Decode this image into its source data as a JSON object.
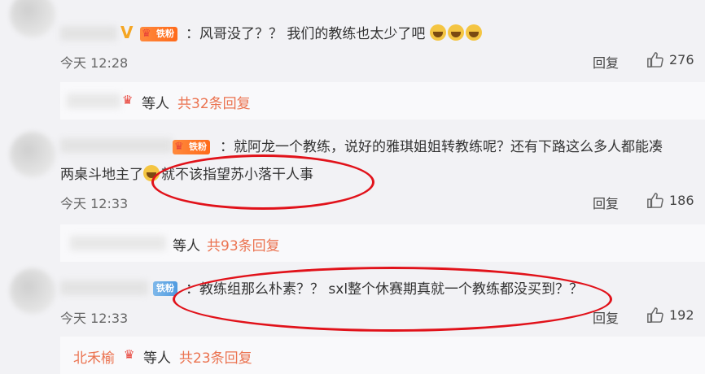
{
  "comments": [
    {
      "badge": "铁粉",
      "text": "：风哥没了？？ 我们的教练也太少了吧",
      "emoji_names": [
        "crying-face-icon",
        "crying-face-icon",
        "crying-face-icon"
      ],
      "time": "今天 12:28",
      "reply_label": "回复",
      "likes": "276",
      "sub": {
        "waiting_label": "等人",
        "total_label": "共32条回复"
      }
    },
    {
      "badge": "铁粉",
      "text_line1": "：就阿龙一个教练，说好的雅琪姐姐转教练呢？还有下路这么多人都能凑",
      "text_line2_a": "两桌斗地主了",
      "text_line2_b": "就不该指望苏小落干人事",
      "time": "今天 12:33",
      "reply_label": "回复",
      "likes": "186",
      "sub": {
        "waiting_label": "等人",
        "total_label": "共93条回复"
      }
    },
    {
      "badge": "铁粉",
      "text": "：教练组那么朴素？？ sxl整个休赛期真就一个教练都没买到？？",
      "time": "今天 12:33",
      "reply_label": "回复",
      "likes": "192",
      "sub": {
        "reply_user": "北禾榆",
        "waiting_label": "等人",
        "total_label": "共23条回复"
      }
    }
  ],
  "colors": {
    "accent": "#eb7350",
    "annotation": "#e1121a"
  }
}
